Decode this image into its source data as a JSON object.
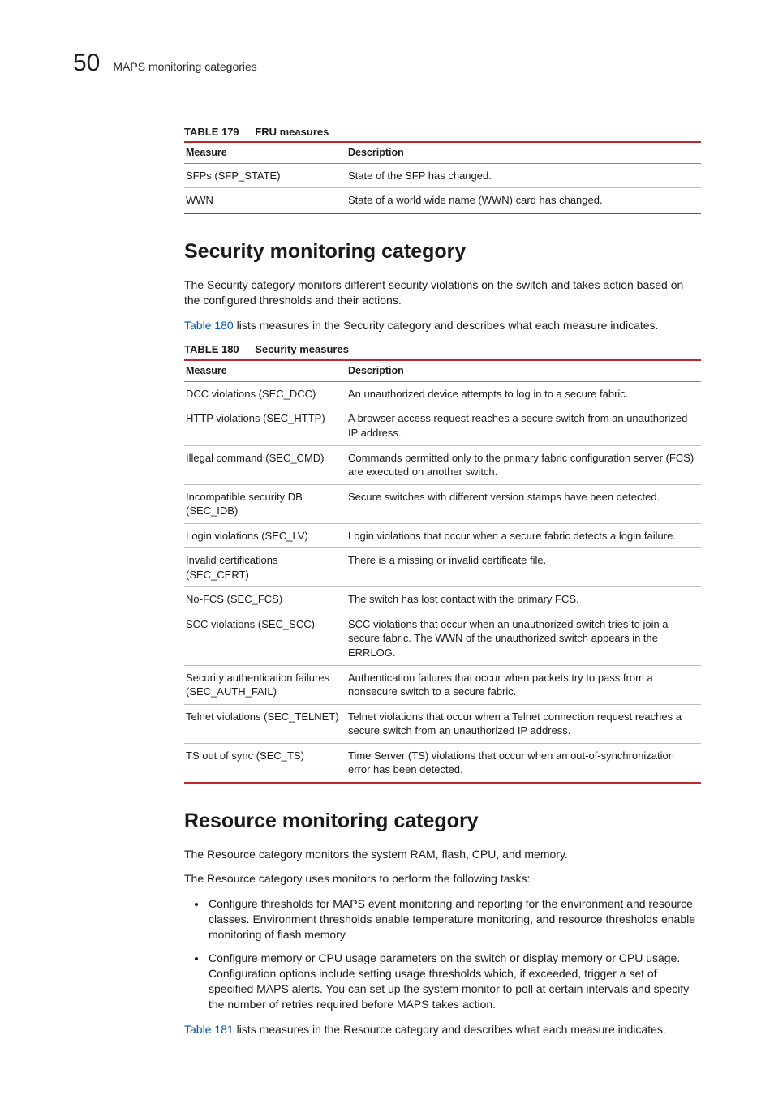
{
  "page": {
    "number": "50",
    "breadcrumb": "MAPS monitoring categories"
  },
  "table179": {
    "label": "TABLE 179",
    "title": "FRU measures",
    "headers": {
      "measure": "Measure",
      "description": "Description"
    },
    "rows": [
      {
        "measure": "SFPs (SFP_STATE)",
        "description": "State of the SFP has changed."
      },
      {
        "measure": "WWN",
        "description": "State of a world wide name (WWN) card has changed."
      }
    ]
  },
  "security": {
    "heading": "Security monitoring category",
    "para1": "The Security category monitors different security violations on the switch and takes action based on the configured thresholds and their actions.",
    "para2_link": "Table 180",
    "para2_rest": " lists measures in the Security category and describes what each measure indicates."
  },
  "table180": {
    "label": "TABLE 180",
    "title": "Security measures",
    "headers": {
      "measure": "Measure",
      "description": "Description"
    },
    "rows": [
      {
        "measure": "DCC violations (SEC_DCC)",
        "description": "An unauthorized device attempts to log in to a secure fabric."
      },
      {
        "measure": "HTTP violations (SEC_HTTP)",
        "description": "A browser access request reaches a secure switch from an unauthorized IP address."
      },
      {
        "measure": "Illegal command (SEC_CMD)",
        "description": "Commands permitted only to the primary fabric configuration server (FCS) are executed on another switch."
      },
      {
        "measure": "Incompatible security DB (SEC_IDB)",
        "description": "Secure switches with different version stamps have been detected."
      },
      {
        "measure": "Login violations (SEC_LV)",
        "description": "Login violations that occur when a secure fabric detects a login failure."
      },
      {
        "measure": "Invalid certifications (SEC_CERT)",
        "description": "There is a missing or invalid certificate file."
      },
      {
        "measure": "No-FCS (SEC_FCS)",
        "description": "The switch has lost contact with the primary FCS."
      },
      {
        "measure": "SCC violations (SEC_SCC)",
        "description": "SCC violations that occur when an unauthorized switch tries to join a secure fabric. The WWN of the unauthorized switch appears in the ERRLOG."
      },
      {
        "measure": "Security authentication failures (SEC_AUTH_FAIL)",
        "description": "Authentication failures that occur when packets try to pass from a nonsecure switch to a secure fabric."
      },
      {
        "measure": "Telnet violations (SEC_TELNET)",
        "description": "Telnet violations that occur when a Telnet connection request reaches a secure switch from an unauthorized IP address."
      },
      {
        "measure": "TS out of sync (SEC_TS)",
        "description": "Time Server (TS) violations that occur when an out-of-synchronization error has been detected."
      }
    ]
  },
  "resource": {
    "heading": "Resource monitoring category",
    "para1": "The Resource category monitors the system RAM, flash, CPU, and memory.",
    "para2": "The Resource category uses monitors to perform the following tasks:",
    "bullets": [
      "Configure thresholds for MAPS event monitoring and reporting for the environment and resource classes. Environment thresholds enable temperature monitoring, and resource thresholds enable monitoring of flash memory.",
      "Configure memory or CPU usage parameters on the switch or display memory or CPU usage. Configuration options include setting usage thresholds which, if exceeded, trigger a set of specified MAPS alerts. You can set up the system monitor to poll at certain intervals and specify the number of retries required before MAPS takes action."
    ],
    "para3_link": "Table 181",
    "para3_rest": " lists measures in the Resource category and describes what each measure indicates."
  }
}
